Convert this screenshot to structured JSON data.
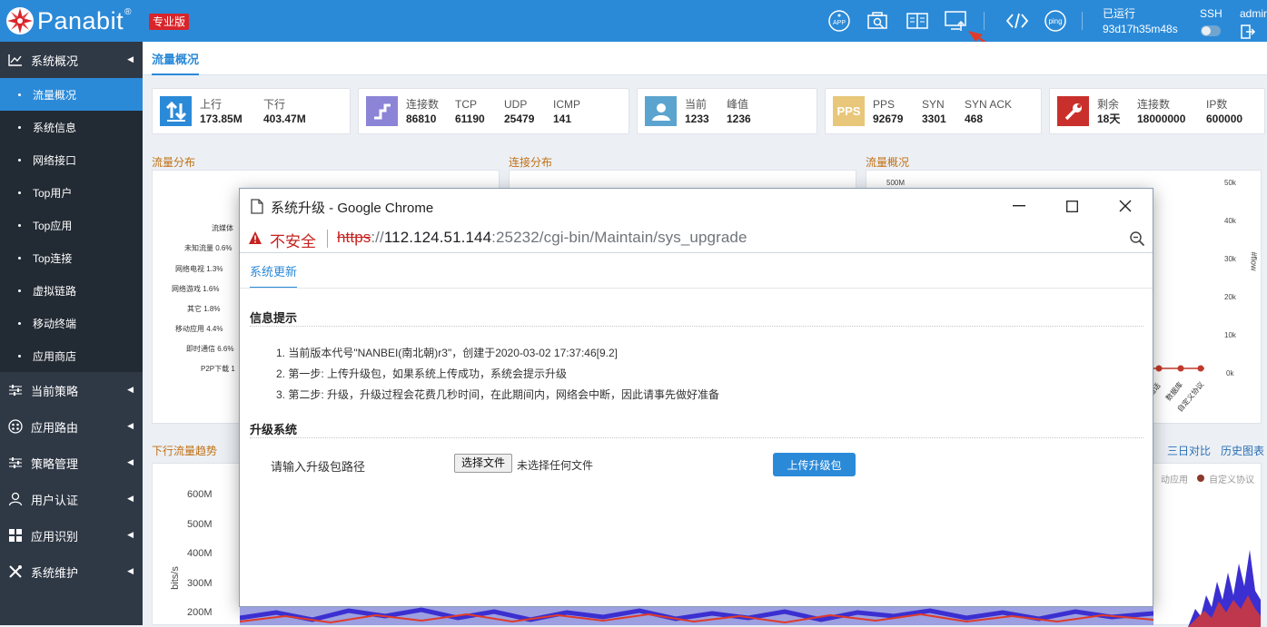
{
  "app": {
    "logo_text": "Panabit",
    "logo_reg": "®",
    "edition_badge": "专业版",
    "uptime_label": "已运行",
    "uptime_value": "93d17h35m48s",
    "ssh_label": "SSH",
    "admin_label": "admin"
  },
  "header_icons": [
    "app-icon",
    "search-device-icon",
    "report-icon",
    "upgrade-icon",
    "code-icon",
    "ping-icon",
    "ssh-toggle-icon",
    "logout-icon"
  ],
  "header_text": {
    "ping": "ping",
    "app": "APP"
  },
  "sidebar": {
    "sections": [
      {
        "label": "系统概况",
        "icon": "chart-line-icon"
      },
      {
        "label": "当前策略",
        "icon": "sliders-icon"
      },
      {
        "label": "应用路由",
        "icon": "route-icon"
      },
      {
        "label": "策略管理",
        "icon": "sliders-icon"
      },
      {
        "label": "用户认证",
        "icon": "user-icon"
      },
      {
        "label": "应用识别",
        "icon": "grid-icon"
      },
      {
        "label": "系统维护",
        "icon": "tools-icon"
      }
    ],
    "submenu": [
      {
        "label": "流量概况",
        "active": true
      },
      {
        "label": "系统信息"
      },
      {
        "label": "网络接口"
      },
      {
        "label": "Top用户"
      },
      {
        "label": "Top应用"
      },
      {
        "label": "Top连接"
      },
      {
        "label": "虚拟链路"
      },
      {
        "label": "移动终端"
      },
      {
        "label": "应用商店"
      }
    ]
  },
  "main": {
    "tab_active": "流量概况",
    "cards": [
      {
        "icon": "updown-icon",
        "color": "#2b8ad8",
        "stats": [
          {
            "label": "上行",
            "value": "173.85M"
          },
          {
            "label": "下行",
            "value": "403.47M"
          }
        ]
      },
      {
        "icon": "connection-icon",
        "color": "#8b84d7",
        "stats": [
          {
            "label": "连接数",
            "value": "86810"
          },
          {
            "label": "TCP",
            "value": "61190"
          },
          {
            "label": "UDP",
            "value": "25479"
          },
          {
            "label": "ICMP",
            "value": "141"
          }
        ]
      },
      {
        "icon": "person-icon",
        "color": "#5ba4cf",
        "stats": [
          {
            "label": "当前",
            "value": "1233"
          },
          {
            "label": "峰值",
            "value": "1236"
          }
        ]
      },
      {
        "icon": "pps-icon",
        "icon_text": "PPS",
        "color": "#e8c77a",
        "stats": [
          {
            "label": "PPS",
            "value": "92679"
          },
          {
            "label": "SYN",
            "value": "3301"
          },
          {
            "label": "SYN ACK",
            "value": "468"
          }
        ]
      },
      {
        "icon": "wrench-icon",
        "color": "#c9302c",
        "stats": [
          {
            "label": "剩余",
            "value": "18天"
          },
          {
            "label": "连接数",
            "value": "18000000"
          },
          {
            "label": "IP数",
            "value": "600000"
          }
        ]
      }
    ],
    "section_titles": {
      "flow_dist": "流量分布",
      "conn_dist": "连接分布",
      "flow_overview": "流量概况",
      "down_trend": "下行流量趋势"
    },
    "pie_labels": [
      "流媒体",
      "未知流量 0.6%",
      "网络电视 1.3%",
      "网络游戏 1.6%",
      "其它 1.8%",
      "移动应用 4.4%",
      "即时通信 6.6%",
      "P2P下载 1"
    ],
    "right_axis": [
      "50k",
      "40k",
      "30k",
      "20k",
      "10k",
      "0k"
    ],
    "right_axis_title": "#flow",
    "left_axis_500m": "500M",
    "x_labels": [
      "通话",
      "数据库",
      "自定义协议"
    ],
    "trend_links": {
      "three_day": "三日对比",
      "history": "历史图表"
    },
    "legend": {
      "mobile_app": "动应用",
      "custom": "自定义协议"
    },
    "trend_yaxis": [
      "600M",
      "500M",
      "400M",
      "300M",
      "200M"
    ],
    "trend_ylabel": "bits/s"
  },
  "popup": {
    "window_title": "系统升级 - Google Chrome",
    "insecure_label": "不安全",
    "url_scheme": "https",
    "url_sep": "://",
    "url_host": "112.124.51.144",
    "url_port": ":25232",
    "url_path": "/cgi-bin/Maintain/sys_upgrade",
    "tab_label": "系统更新",
    "info_heading": "信息提示",
    "info_lines": [
      "1. 当前版本代号\"NANBEI(南北朝)r3\"，创建于2020-03-02 17:37:46[9.2]",
      "2. 第一步: 上传升级包，如果系统上传成功，系统会提示升级",
      "3. 第二步: 升级，升级过程会花费几秒时间，在此期间内，网络会中断，因此请事先做好准备"
    ],
    "upgrade_heading": "升级系统",
    "path_label": "请输入升级包路径",
    "choose_file": "选择文件",
    "no_file": "未选择任何文件",
    "upload_button": "上传升级包"
  }
}
